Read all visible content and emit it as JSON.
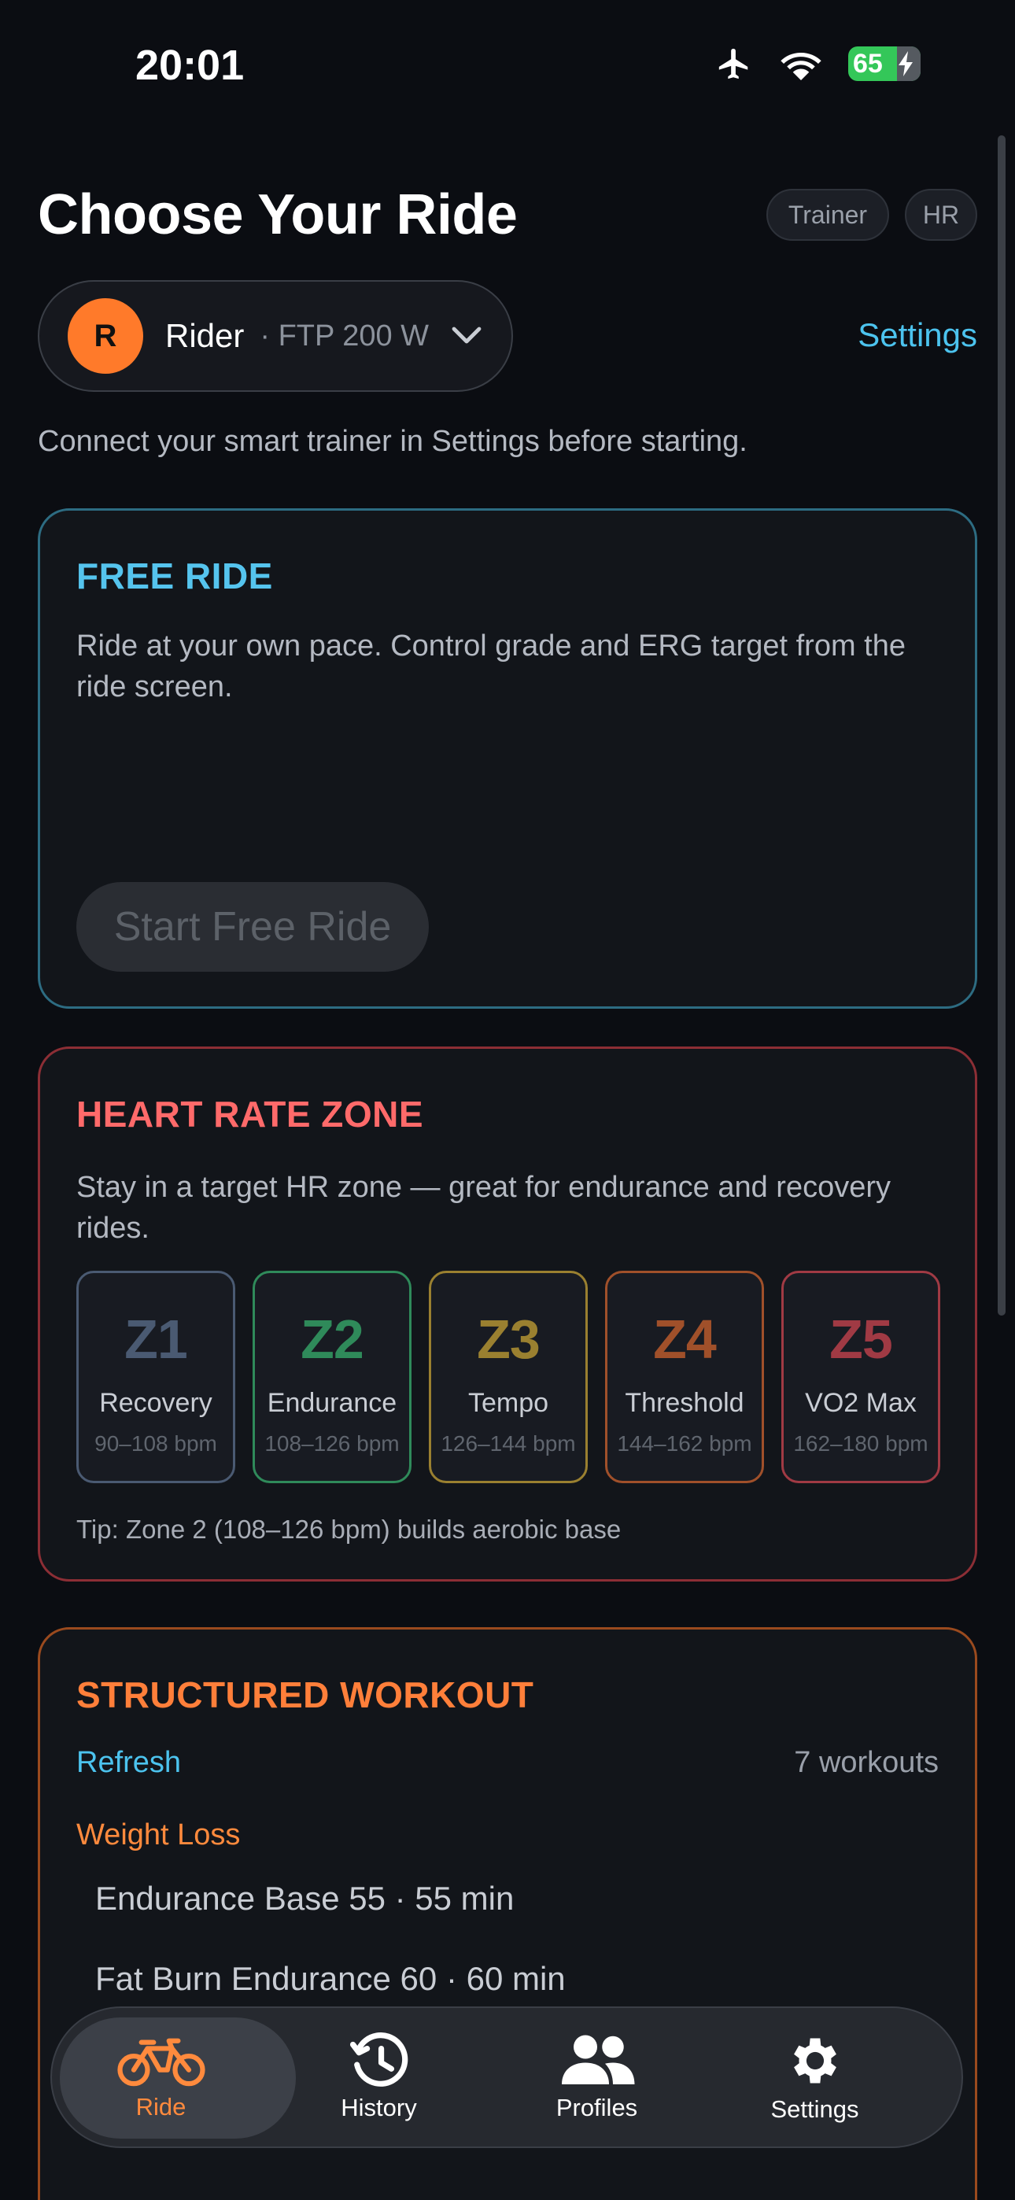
{
  "status_bar": {
    "time": "20:01",
    "battery": "65"
  },
  "header": {
    "title": "Choose Your Ride",
    "badges": [
      "Trainer",
      "HR"
    ],
    "settings_link": "Settings"
  },
  "rider": {
    "initial": "R",
    "name": "Rider",
    "ftp": "· FTP 200 W"
  },
  "hint": "Connect your smart trainer in Settings before starting.",
  "free_ride": {
    "title": "FREE RIDE",
    "description": "Ride at your own pace. Control grade and ERG target from the ride screen.",
    "button": "Start Free Ride"
  },
  "heart_rate": {
    "title": "HEART RATE ZONE",
    "description": "Stay in a target HR zone — great for endurance and recovery rides.",
    "zones": [
      {
        "id": "Z1",
        "name": "Recovery",
        "range": "90–108 bpm",
        "color": "#4a5a72"
      },
      {
        "id": "Z2",
        "name": "Endurance",
        "range": "108–126 bpm",
        "color": "#2f8a5a"
      },
      {
        "id": "Z3",
        "name": "Tempo",
        "range": "126–144 bpm",
        "color": "#9a8030"
      },
      {
        "id": "Z4",
        "name": "Threshold",
        "range": "144–162 bpm",
        "color": "#a0502a"
      },
      {
        "id": "Z5",
        "name": "VO2 Max",
        "range": "162–180 bpm",
        "color": "#a03a44"
      }
    ],
    "tip": "Tip: Zone 2 (108–126 bpm) builds aerobic base"
  },
  "workout": {
    "title": "STRUCTURED WORKOUT",
    "refresh": "Refresh",
    "count": "7 workouts",
    "category": "Weight Loss",
    "items": [
      "Endurance Base 55 · 55 min",
      "Fat Burn Endurance 60 · 60 min"
    ]
  },
  "tabs": [
    {
      "label": "Ride",
      "icon": "bike-icon"
    },
    {
      "label": "History",
      "icon": "history-icon"
    },
    {
      "label": "Profiles",
      "icon": "people-icon"
    },
    {
      "label": "Settings",
      "icon": "gear-icon"
    }
  ],
  "colors": {
    "accent_blue": "#4cc3ee",
    "accent_orange": "#ff7a2a",
    "free_ride_title": "#55c4ee",
    "hr_title": "#ff6a6a",
    "workout_title": "#ff7f3a"
  }
}
